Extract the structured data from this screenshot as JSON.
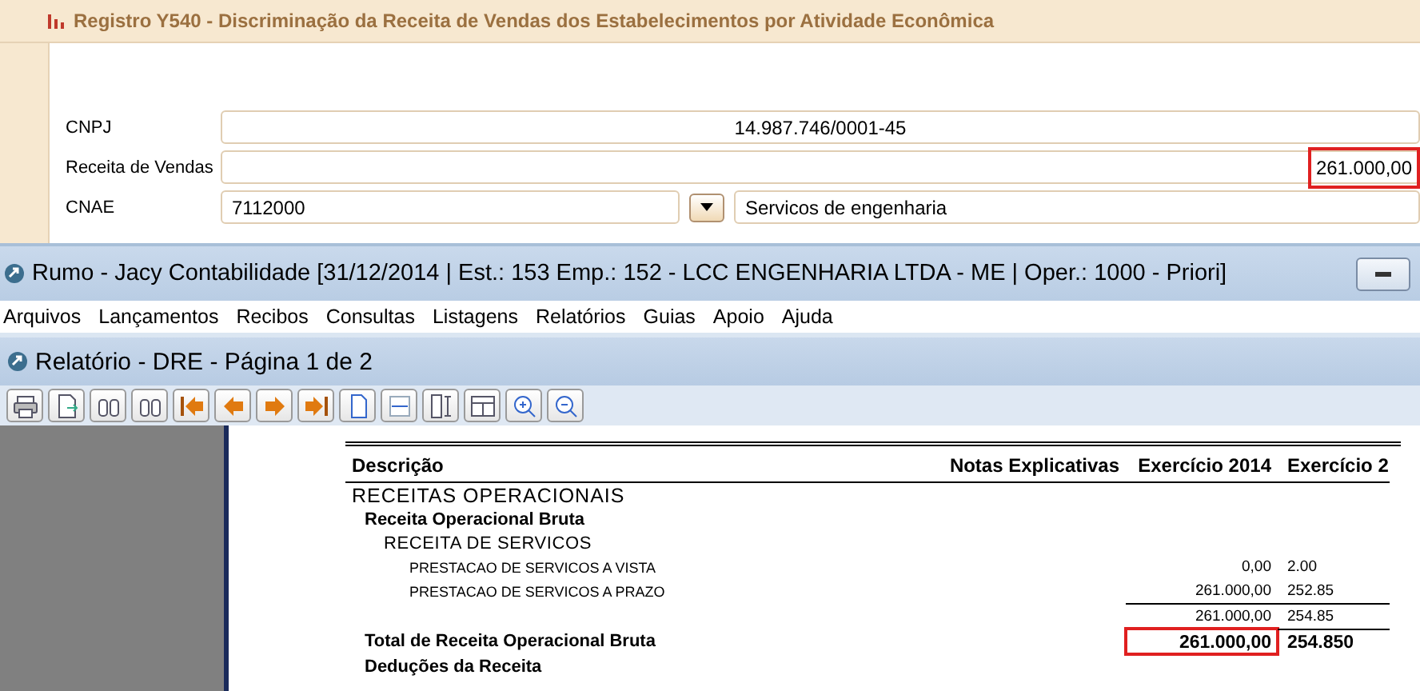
{
  "form_panel": {
    "title": "Registro Y540 - Discriminação da Receita de Vendas dos Estabelecimentos por Atividade Econômica",
    "fields": [
      {
        "kind": "centered",
        "label": "CNPJ",
        "value": "14.987.746/0001-45",
        "highlighted": false
      },
      {
        "kind": "amount",
        "label": "Receita de Vendas",
        "value": "261.000,00",
        "highlighted": true
      },
      {
        "kind": "lookup",
        "label": "CNAE",
        "value": "7112000",
        "description": "Servicos de engenharia",
        "highlighted": false
      }
    ]
  },
  "window": {
    "title": "Rumo - Jacy Contabilidade [31/12/2014 | Est.: 153 Emp.: 152 - LCC ENGENHARIA LTDA - ME | Oper.: 1000 - Priori]",
    "menu": [
      "Arquivos",
      "Lançamentos",
      "Recibos",
      "Consultas",
      "Listagens",
      "Relatórios",
      "Guias",
      "Apoio",
      "Ajuda"
    ]
  },
  "report_window": {
    "title": "Relatório - DRE - Página 1 de 2"
  },
  "report": {
    "columns": [
      "Descrição",
      "Notas Explicativas",
      "Exercício 2014",
      "Exercício 2"
    ],
    "rows": [
      {
        "kind": "section",
        "label": "RECEITAS OPERACIONAIS",
        "highlighted": false
      },
      {
        "kind": "group",
        "label": "Receita Operacional Bruta",
        "highlighted": false
      },
      {
        "kind": "subgroup",
        "label": "RECEITA DE SERVICOS",
        "highlighted": false
      },
      {
        "kind": "item",
        "label": "PRESTACAO DE SERVICOS A VISTA",
        "exercicio_2014": "0,00",
        "column_4": "2.00",
        "highlighted": false
      },
      {
        "kind": "item",
        "label": "PRESTACAO DE SERVICOS A PRAZO",
        "exercicio_2014": "261.000,00",
        "column_4": "252.85",
        "highlighted": false
      },
      {
        "kind": "subtotal",
        "exercicio_2014": "261.000,00",
        "column_4": "254.85",
        "highlighted": false
      },
      {
        "kind": "total",
        "label": "Total de Receita Operacional Bruta",
        "exercicio_2014": "261.000,00",
        "column_4": "254.850",
        "highlighted": true
      },
      {
        "kind": "group",
        "label": "Deduções da Receita",
        "highlighted": false
      }
    ]
  }
}
